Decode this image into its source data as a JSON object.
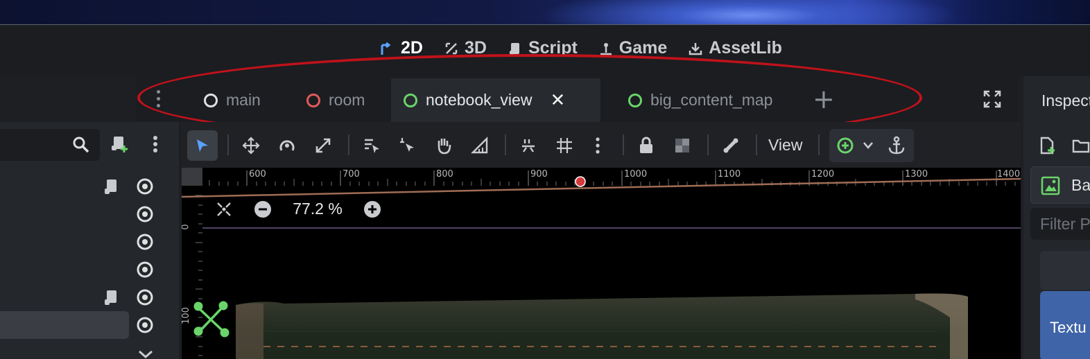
{
  "main_screens": [
    {
      "label": "2D",
      "icon": "2d-icon",
      "active": true
    },
    {
      "label": "3D",
      "icon": "3d-icon",
      "active": false
    },
    {
      "label": "Script",
      "icon": "script-icon",
      "active": false
    },
    {
      "label": "Game",
      "icon": "game-icon",
      "active": false
    },
    {
      "label": "AssetLib",
      "icon": "assetlib-icon",
      "active": false
    }
  ],
  "scene_tabs": [
    {
      "label": "main",
      "status_color": "#e0e0e0",
      "active": false
    },
    {
      "label": "room",
      "status_color": "#e05a5a",
      "active": false
    },
    {
      "label": "notebook_view",
      "status_color": "#6ad46a",
      "active": true,
      "close_label": "✕"
    },
    {
      "label": "big_content_map",
      "status_color": "#6ad46a",
      "active": false
    }
  ],
  "add_tab_label": "+",
  "toolbar": {
    "view_label": "View",
    "tools": [
      "select-icon",
      "move-icon",
      "rotate-icon",
      "scale-icon",
      "list-select-icon",
      "pivot-icon",
      "pan-icon",
      "ruler-icon",
      "smart-snap-icon",
      "grid-snap-icon",
      "more-icon",
      "lock-icon",
      "group-icon",
      "bone-icon",
      "add-node-icon",
      "chevron-down-icon",
      "anchor-icon"
    ]
  },
  "ruler": {
    "top_labels": [
      "600",
      "700",
      "800",
      "900",
      "1000",
      "1100",
      "1200",
      "1300",
      "1400"
    ],
    "left_labels": [
      "0",
      "100"
    ]
  },
  "zoom": {
    "level": "77.2 %"
  },
  "inspector": {
    "title": "Inspector",
    "resource_name": "Ba",
    "filter_placeholder": "Filter P",
    "texture_label": "Textu"
  },
  "colors": {
    "accent": "#5aa3ff",
    "highlight_ring": "#c0121a",
    "selection_blue": "#3f64a8"
  }
}
